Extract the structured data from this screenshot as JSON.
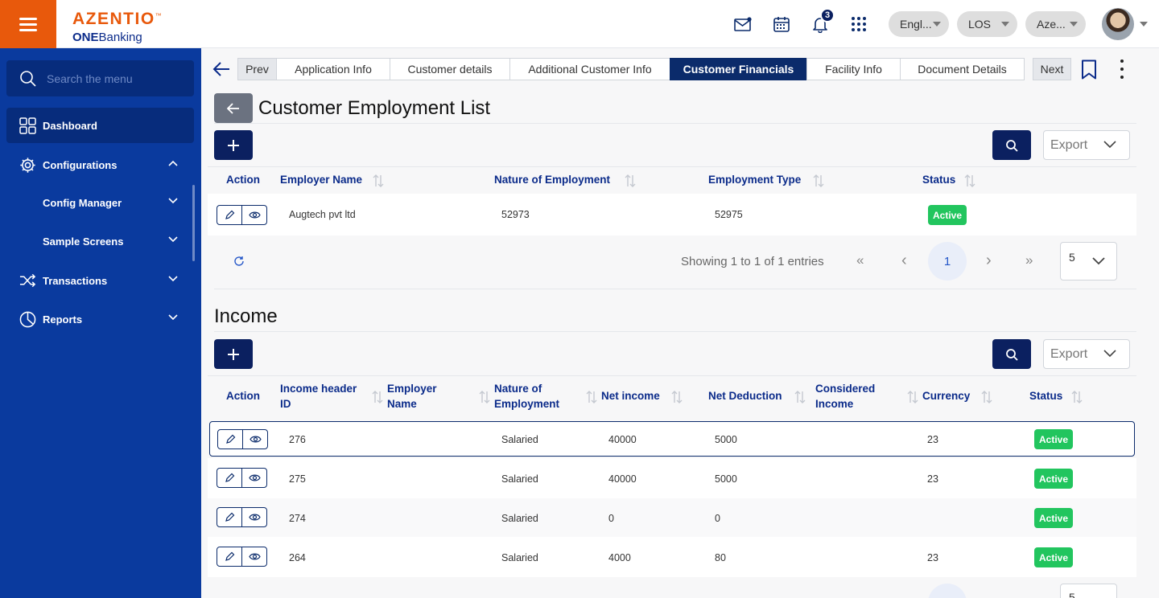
{
  "brand": {
    "name": "AZENTIO",
    "tm": "™",
    "sub_bold": "ONE",
    "sub_rest": "Banking"
  },
  "header": {
    "notification_count": "3",
    "language": "Engl...",
    "module": "LOS",
    "entity": "Aze..."
  },
  "sidebar": {
    "search_placeholder": "Search the menu",
    "items": [
      {
        "label": "Dashboard",
        "icon": "grid-icon"
      },
      {
        "label": "Configurations",
        "icon": "gear-icon"
      },
      {
        "label": "Config Manager"
      },
      {
        "label": "Sample Screens"
      },
      {
        "label": "Transactions",
        "icon": "shuffle-icon"
      },
      {
        "label": "Reports",
        "icon": "pie-chart-icon"
      }
    ]
  },
  "tabs": {
    "prev": "Prev",
    "items": [
      "Application Info",
      "Customer details",
      "Additional Customer Info",
      "Customer Financials",
      "Facility Info",
      "Document Details"
    ],
    "next": "Next",
    "active": "Customer Financials"
  },
  "employment": {
    "title": "Customer Employment List",
    "export": "Export",
    "columns": [
      "Action",
      "Employer Name",
      "Nature of Employment",
      "Employment Type",
      "Status"
    ],
    "rows": [
      {
        "employer": "Augtech pvt ltd",
        "nature": "52973",
        "type": "52975",
        "status": "Active"
      }
    ],
    "pager": {
      "summary": "Showing 1 to 1 of 1 entries",
      "first": "«",
      "prev": "‹",
      "page": "1",
      "next": "›",
      "last": "»",
      "per_page": "5"
    }
  },
  "income": {
    "title": "Income",
    "export": "Export",
    "columns": {
      "action": "Action",
      "id_1": "Income header",
      "id_2": "ID",
      "employer_1": "Employer",
      "employer_2": "Name",
      "nature_1": "Nature of",
      "nature_2": "Employment",
      "net_income": "Net income",
      "net_deduction": "Net Deduction",
      "considered_1": "Considered",
      "considered_2": "Income",
      "currency": "Currency",
      "status": "Status"
    },
    "rows": [
      {
        "id": "276",
        "employer": "",
        "nature": "Salaried",
        "net_income": "40000",
        "net_deduction": "5000",
        "considered": "",
        "currency": "23",
        "status": "Active"
      },
      {
        "id": "275",
        "employer": "",
        "nature": "Salaried",
        "net_income": "40000",
        "net_deduction": "5000",
        "considered": "",
        "currency": "23",
        "status": "Active"
      },
      {
        "id": "274",
        "employer": "",
        "nature": "Salaried",
        "net_income": "0",
        "net_deduction": "0",
        "considered": "",
        "currency": "",
        "status": "Active"
      },
      {
        "id": "264",
        "employer": "",
        "nature": "Salaried",
        "net_income": "4000",
        "net_deduction": "80",
        "considered": "",
        "currency": "23",
        "status": "Active"
      }
    ],
    "per_page": "5"
  },
  "colors": {
    "accent_orange": "#e8590c",
    "sidebar_blue": "#0a3a9e",
    "navy": "#0b2060",
    "active_green": "#22c55e"
  }
}
